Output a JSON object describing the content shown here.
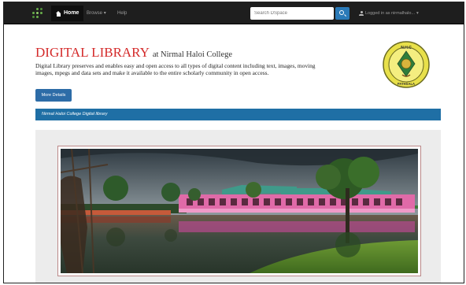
{
  "navbar": {
    "home_label": "Home",
    "browse_label": "Browse",
    "help_label": "Help",
    "search_placeholder": "Search DSpace",
    "user_label": "Logged in as nirmalhalo..."
  },
  "header": {
    "title_main": "DIGITAL LIBRARY",
    "title_sub": "at Nirmal Haloi College",
    "description": "Digital Library preserves and enables easy and open access to all types of digital content including text, images, moving images, mpegs and data sets and make it available to the entire scholarly community in open access.",
    "details_button": "More Details"
  },
  "breadcrumb": {
    "label": "Nirmal Haloi College Digital library"
  },
  "seal": {
    "text_top": "N.H.C",
    "text_bottom": "PATHSALA"
  },
  "colors": {
    "navbar": "#1e1e1e",
    "title": "#d42a2a",
    "accent_blue": "#1f6fa5",
    "button_blue": "#2d6ca7"
  }
}
